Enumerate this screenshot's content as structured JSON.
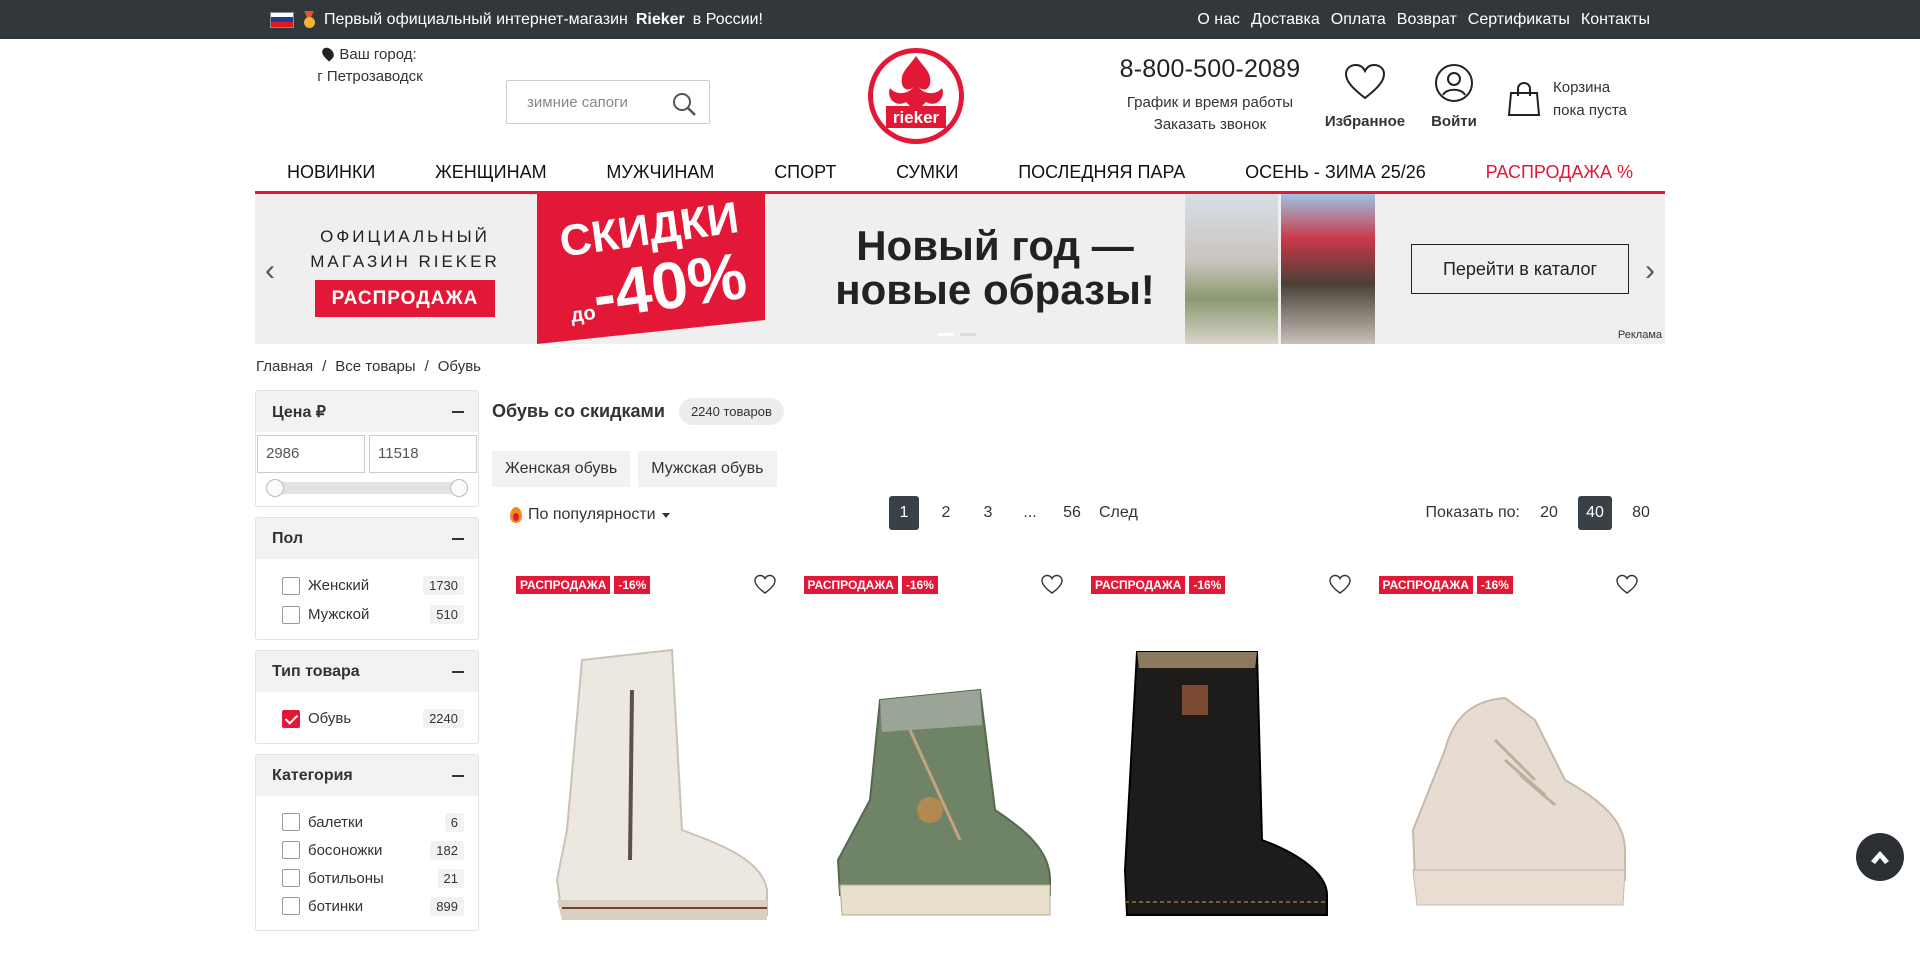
{
  "topbar": {
    "promo_prefix": "Первый официальный интернет-магазин",
    "promo_brand": "Rieker",
    "promo_suffix": "в России!",
    "links": [
      "О нас",
      "Доставка",
      "Оплата",
      "Возврат",
      "Сертификаты",
      "Контакты"
    ]
  },
  "header": {
    "city_label": "Ваш город:",
    "city_value": "г Петрозаводск",
    "search_placeholder": "зимние сапоги",
    "logo_text": "rieker",
    "phone": "8-800-500-2089",
    "schedule_link": "График и время работы",
    "callback_link": "Заказать звонок",
    "favorites_label": "Избранное",
    "login_label": "Войти",
    "cart_title": "Корзина",
    "cart_status": "пока пуста"
  },
  "nav": [
    "НОВИНКИ",
    "ЖЕНЩИНАМ",
    "МУЖЧИНАМ",
    "СПОРТ",
    "СУМКИ",
    "ПОСЛЕДНЯЯ ПАРА",
    "ОСЕНЬ - ЗИМА 25/26",
    "РАСПРОДАЖА %"
  ],
  "banner": {
    "line1": "ОФИЦИАЛЬНЫЙ",
    "line2": "МАГАЗИН RIEKER",
    "sale_badge": "РАСПРОДАЖА",
    "discount_word": "СКИДКИ",
    "discount_prefix": "до",
    "discount_value": "-40%",
    "headline1": "Новый год —",
    "headline2": "новые образы!",
    "cta": "Перейти в каталог",
    "ad_label": "Реклама"
  },
  "breadcrumbs": [
    "Главная",
    "Все товары",
    "Обувь"
  ],
  "filters": {
    "price": {
      "title": "Цена ₽",
      "min": "2986",
      "max": "11518"
    },
    "gender": {
      "title": "Пол",
      "options": [
        {
          "label": "Женский",
          "count": "1730"
        },
        {
          "label": "Мужской",
          "count": "510"
        }
      ]
    },
    "type": {
      "title": "Тип товара",
      "options": [
        {
          "label": "Обувь",
          "count": "2240",
          "checked": true
        }
      ]
    },
    "category": {
      "title": "Категория",
      "options": [
        {
          "label": "балетки",
          "count": "6"
        },
        {
          "label": "босоножки",
          "count": "182"
        },
        {
          "label": "ботильоны",
          "count": "21"
        },
        {
          "label": "ботинки",
          "count": "899"
        }
      ]
    }
  },
  "listing": {
    "title": "Обувь со скидками",
    "count": "2240 товаров",
    "chips": [
      "Женская обувь",
      "Мужская обувь"
    ],
    "sort_label": "По популярности",
    "pages": [
      "1",
      "2",
      "3",
      "...",
      "56",
      "След"
    ],
    "current_page": "1",
    "show_label": "Показать по:",
    "page_sizes": [
      "20",
      "40",
      "80"
    ],
    "current_size": "40"
  },
  "products": [
    {
      "tag": "РАСПРОДАЖА",
      "discount": "-16%",
      "color": "#ece8df"
    },
    {
      "tag": "РАСПРОДАЖА",
      "discount": "-16%",
      "color": "#6f8466"
    },
    {
      "tag": "РАСПРОДАЖА",
      "discount": "-16%",
      "color": "#1e1c1a"
    },
    {
      "tag": "РАСПРОДАЖА",
      "discount": "-16%",
      "color": "#e6dcd2"
    }
  ],
  "colors": {
    "accent": "#e31837",
    "topbar": "#32373c",
    "active_page": "#3a4146"
  }
}
